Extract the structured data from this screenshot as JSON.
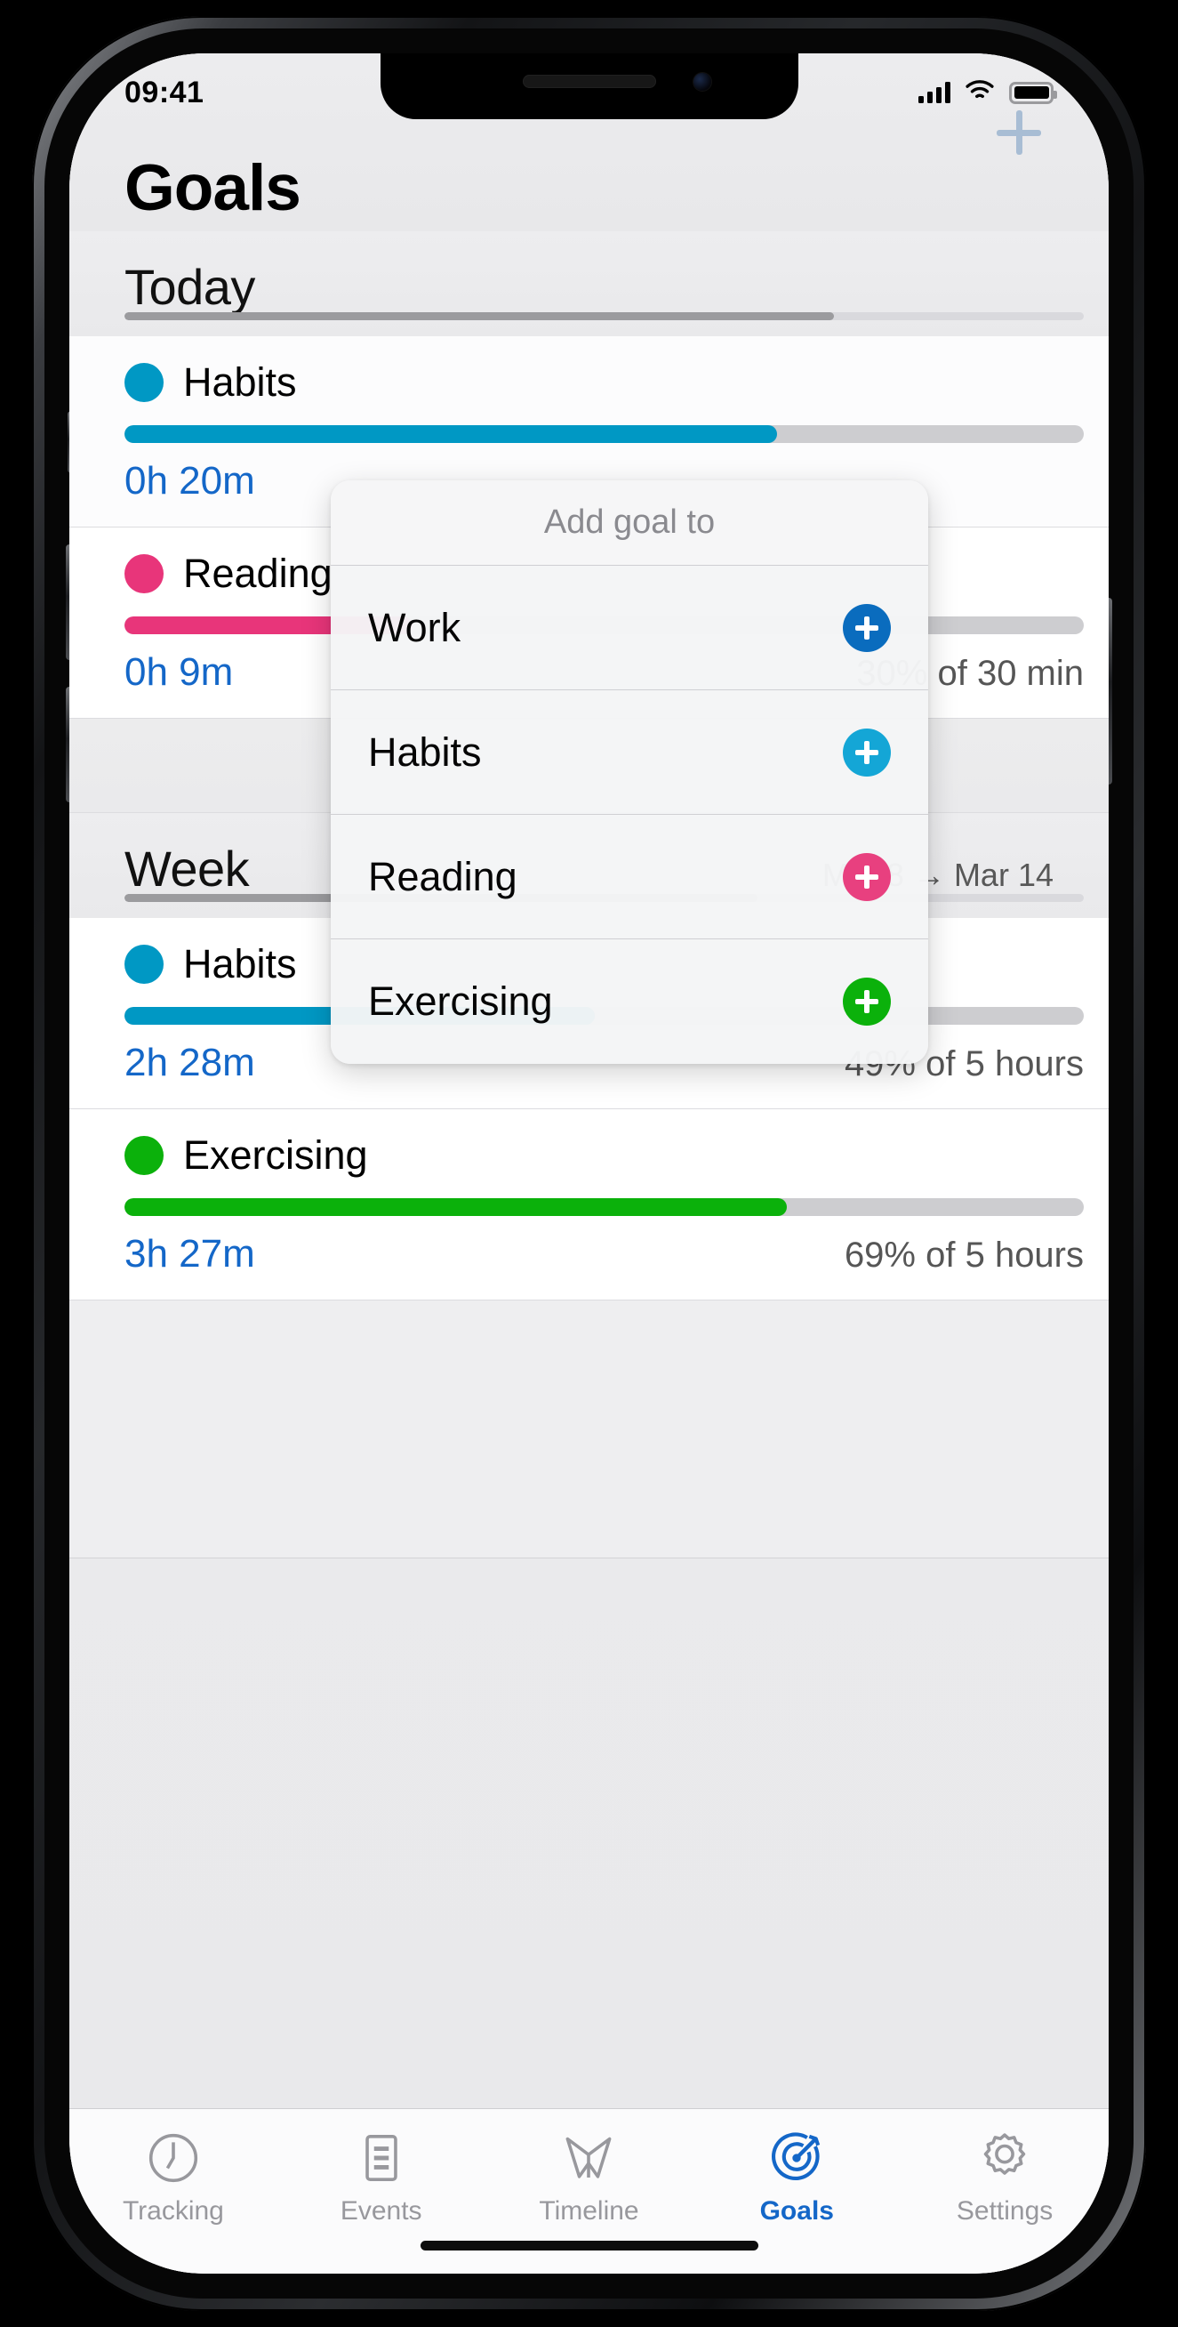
{
  "status_bar": {
    "time": "09:41",
    "signal_icon": "cellular-signal-icon",
    "wifi_icon": "wifi-icon",
    "battery_icon": "battery-full-icon"
  },
  "header": {
    "title": "Goals",
    "add_button_icon": "plus-icon"
  },
  "popover": {
    "title": "Add goal to",
    "items": [
      {
        "label": "Work",
        "color": "#0a6cbe"
      },
      {
        "label": "Habits",
        "color": "#14a6d6"
      },
      {
        "label": "Reading",
        "color": "#e8407f"
      },
      {
        "label": "Exercising",
        "color": "#0bb10b"
      }
    ]
  },
  "sections": [
    {
      "title": "Today",
      "range": "",
      "progress_pct": 74,
      "goals": [
        {
          "name": "Habits",
          "color": "#0098c4",
          "time": "0h 20m",
          "percent_label": "",
          "progress_pct": 68
        },
        {
          "name": "Reading",
          "color": "#e8357a",
          "time": "0h 9m",
          "percent_label": "30% of 30 min",
          "progress_pct": 30
        }
      ]
    },
    {
      "title": "Week",
      "range": "Mar 8 → Mar 14",
      "progress_pct": 66,
      "goals": [
        {
          "name": "Habits",
          "color": "#0098c4",
          "time": "2h 28m",
          "percent_label": "49% of 5 hours",
          "progress_pct": 49
        },
        {
          "name": "Exercising",
          "color": "#0bb10b",
          "time": "3h 27m",
          "percent_label": "69% of 5 hours",
          "progress_pct": 69
        }
      ]
    }
  ],
  "tabbar": {
    "items": [
      {
        "label": "Tracking",
        "icon": "clock-icon",
        "active": false
      },
      {
        "label": "Events",
        "icon": "list-icon",
        "active": false
      },
      {
        "label": "Timeline",
        "icon": "paper-plane-icon",
        "active": false
      },
      {
        "label": "Goals",
        "icon": "target-icon",
        "active": true
      },
      {
        "label": "Settings",
        "icon": "gear-icon",
        "active": false
      }
    ],
    "active_color": "#1467c8",
    "inactive_color": "#98989d"
  }
}
